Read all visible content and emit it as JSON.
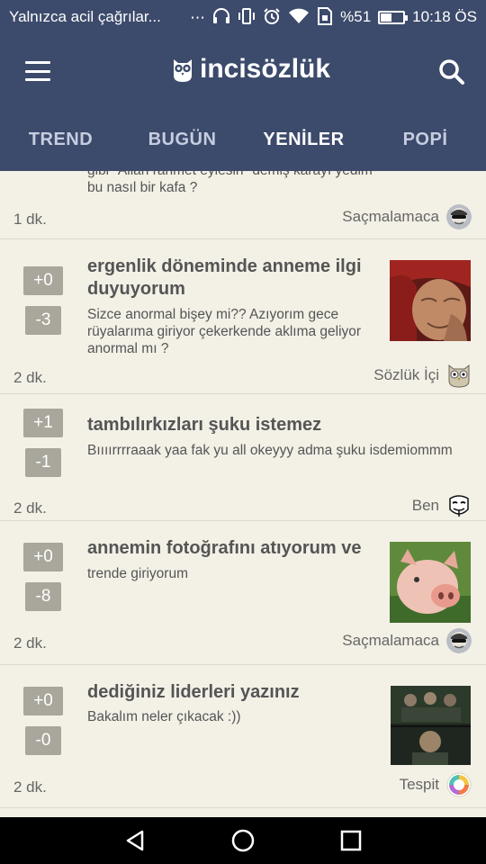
{
  "status_bar": {
    "notification_text": "Yalnızca acil çağrılar...",
    "battery_percent": "%51",
    "battery_level": 0.51,
    "time": "10:18 ÖS",
    "icons": [
      "more-icon",
      "headphones-icon",
      "vibrate-icon",
      "alarm-icon",
      "wifi-icon",
      "sim-icon",
      "battery-icon"
    ]
  },
  "header": {
    "app_name": "incisözlük"
  },
  "tabs": [
    {
      "label": "TREND",
      "active": false
    },
    {
      "label": "BUGÜN",
      "active": false
    },
    {
      "label": "YENİLER",
      "active": true
    },
    {
      "label": "POPİ",
      "active": false
    }
  ],
  "entries": [
    {
      "body_line1": "gibi \"Allah rahmet eylesin\" demiş karayı yedim",
      "body_line2": "bu nasıl bir kafa ?",
      "time": "1 dk.",
      "author": "Saçmalamaca"
    },
    {
      "up": "+0",
      "down": "-3",
      "title": "ergenlik döneminde anneme ilgi duyuyorum",
      "body": "Sizce anormal bişey mi?? Azıyorım gece rüyalarıma giriyor çekerkende aklıma geliyor anormal mı ?",
      "time": "2 dk.",
      "author": "Sözlük İçi",
      "thumb": "old-woman-thumbnail"
    },
    {
      "up": "+1",
      "down": "-1",
      "title": "tambılırkızları şuku istemez",
      "body": "Bıııırrrraaak yaa fak yu all okeyyy adma şuku isdemiommm",
      "time": "2 dk.",
      "author": "Ben"
    },
    {
      "up": "+0",
      "down": "-8",
      "title": "annemin fotoğrafını atıyorum ve",
      "body": "trende giriyorum",
      "time": "2 dk.",
      "author": "Saçmalamaca",
      "thumb": "pig-thumbnail"
    },
    {
      "up": "+0",
      "down": "-0",
      "title": "dediğiniz liderleri yazınız",
      "body": "Bakalım neler çıkacak :))",
      "time": "2 dk.",
      "author": "Tespit",
      "thumb": "group-photo-thumbnail"
    }
  ],
  "colors": {
    "header_bg": "#3c4a6b",
    "feed_bg": "#f3f0e6",
    "vote_bg": "#a9a69c",
    "text": "#555555"
  }
}
